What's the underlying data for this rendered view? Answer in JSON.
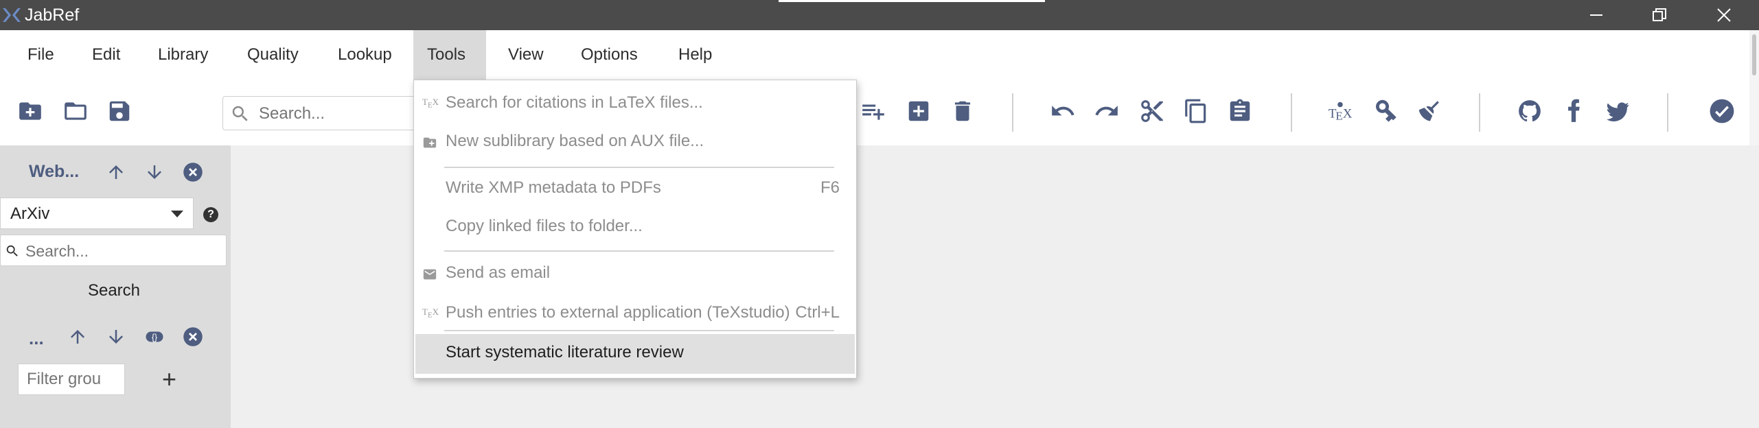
{
  "window": {
    "title": "JabRef"
  },
  "menubar": {
    "items": [
      {
        "label": "File"
      },
      {
        "label": "Edit"
      },
      {
        "label": "Library"
      },
      {
        "label": "Quality"
      },
      {
        "label": "Lookup"
      },
      {
        "label": "Tools"
      },
      {
        "label": "View"
      },
      {
        "label": "Options"
      },
      {
        "label": "Help"
      }
    ],
    "active": "Tools"
  },
  "toolbar": {
    "search_placeholder": "Search...",
    "icons": [
      "new-library-icon",
      "open-folder-icon",
      "save-icon",
      "add-entry-list-icon",
      "add-entry-icon",
      "delete-icon",
      "undo-icon",
      "redo-icon",
      "cut-icon",
      "copy-icon",
      "paste-icon",
      "tex-icon",
      "key-icon",
      "cleanup-broom-icon",
      "github-icon",
      "facebook-icon",
      "twitter-icon",
      "check-circle-icon"
    ],
    "icon_color": "#4e5d80"
  },
  "web_search": {
    "title": "Web...",
    "fetcher_selected": "ArXiv",
    "query_placeholder": "Search...",
    "search_button": "Search"
  },
  "groups": {
    "title": "...",
    "filter_placeholder": "Filter grou",
    "add_label": "+"
  },
  "tools_menu": {
    "items": [
      {
        "label": "Search for citations in LaTeX files...",
        "icon": "tex-icon",
        "shortcut": "",
        "enabled": false
      },
      {
        "label": "New sublibrary based on AUX file...",
        "icon": "new-sublibrary-icon",
        "shortcut": "",
        "enabled": false
      },
      {
        "label": "Write XMP metadata to PDFs",
        "icon": "",
        "shortcut": "F6",
        "enabled": false
      },
      {
        "label": "Copy linked files to folder...",
        "icon": "",
        "shortcut": "",
        "enabled": false
      },
      {
        "label": "Send as email",
        "icon": "envelope-icon",
        "shortcut": "",
        "enabled": false
      },
      {
        "label": "Push entries to external application (TeXstudio)",
        "icon": "tex-icon",
        "shortcut": "Ctrl+L",
        "enabled": false
      },
      {
        "label": "Start systematic literature review",
        "icon": "",
        "shortcut": "",
        "enabled": true,
        "highlighted": true
      }
    ]
  },
  "colors": {
    "titlebar": "#4b4b4b",
    "accent": "#4e5d80",
    "sidepanel": "#dcdcdc",
    "menu_active": "#dadada"
  }
}
